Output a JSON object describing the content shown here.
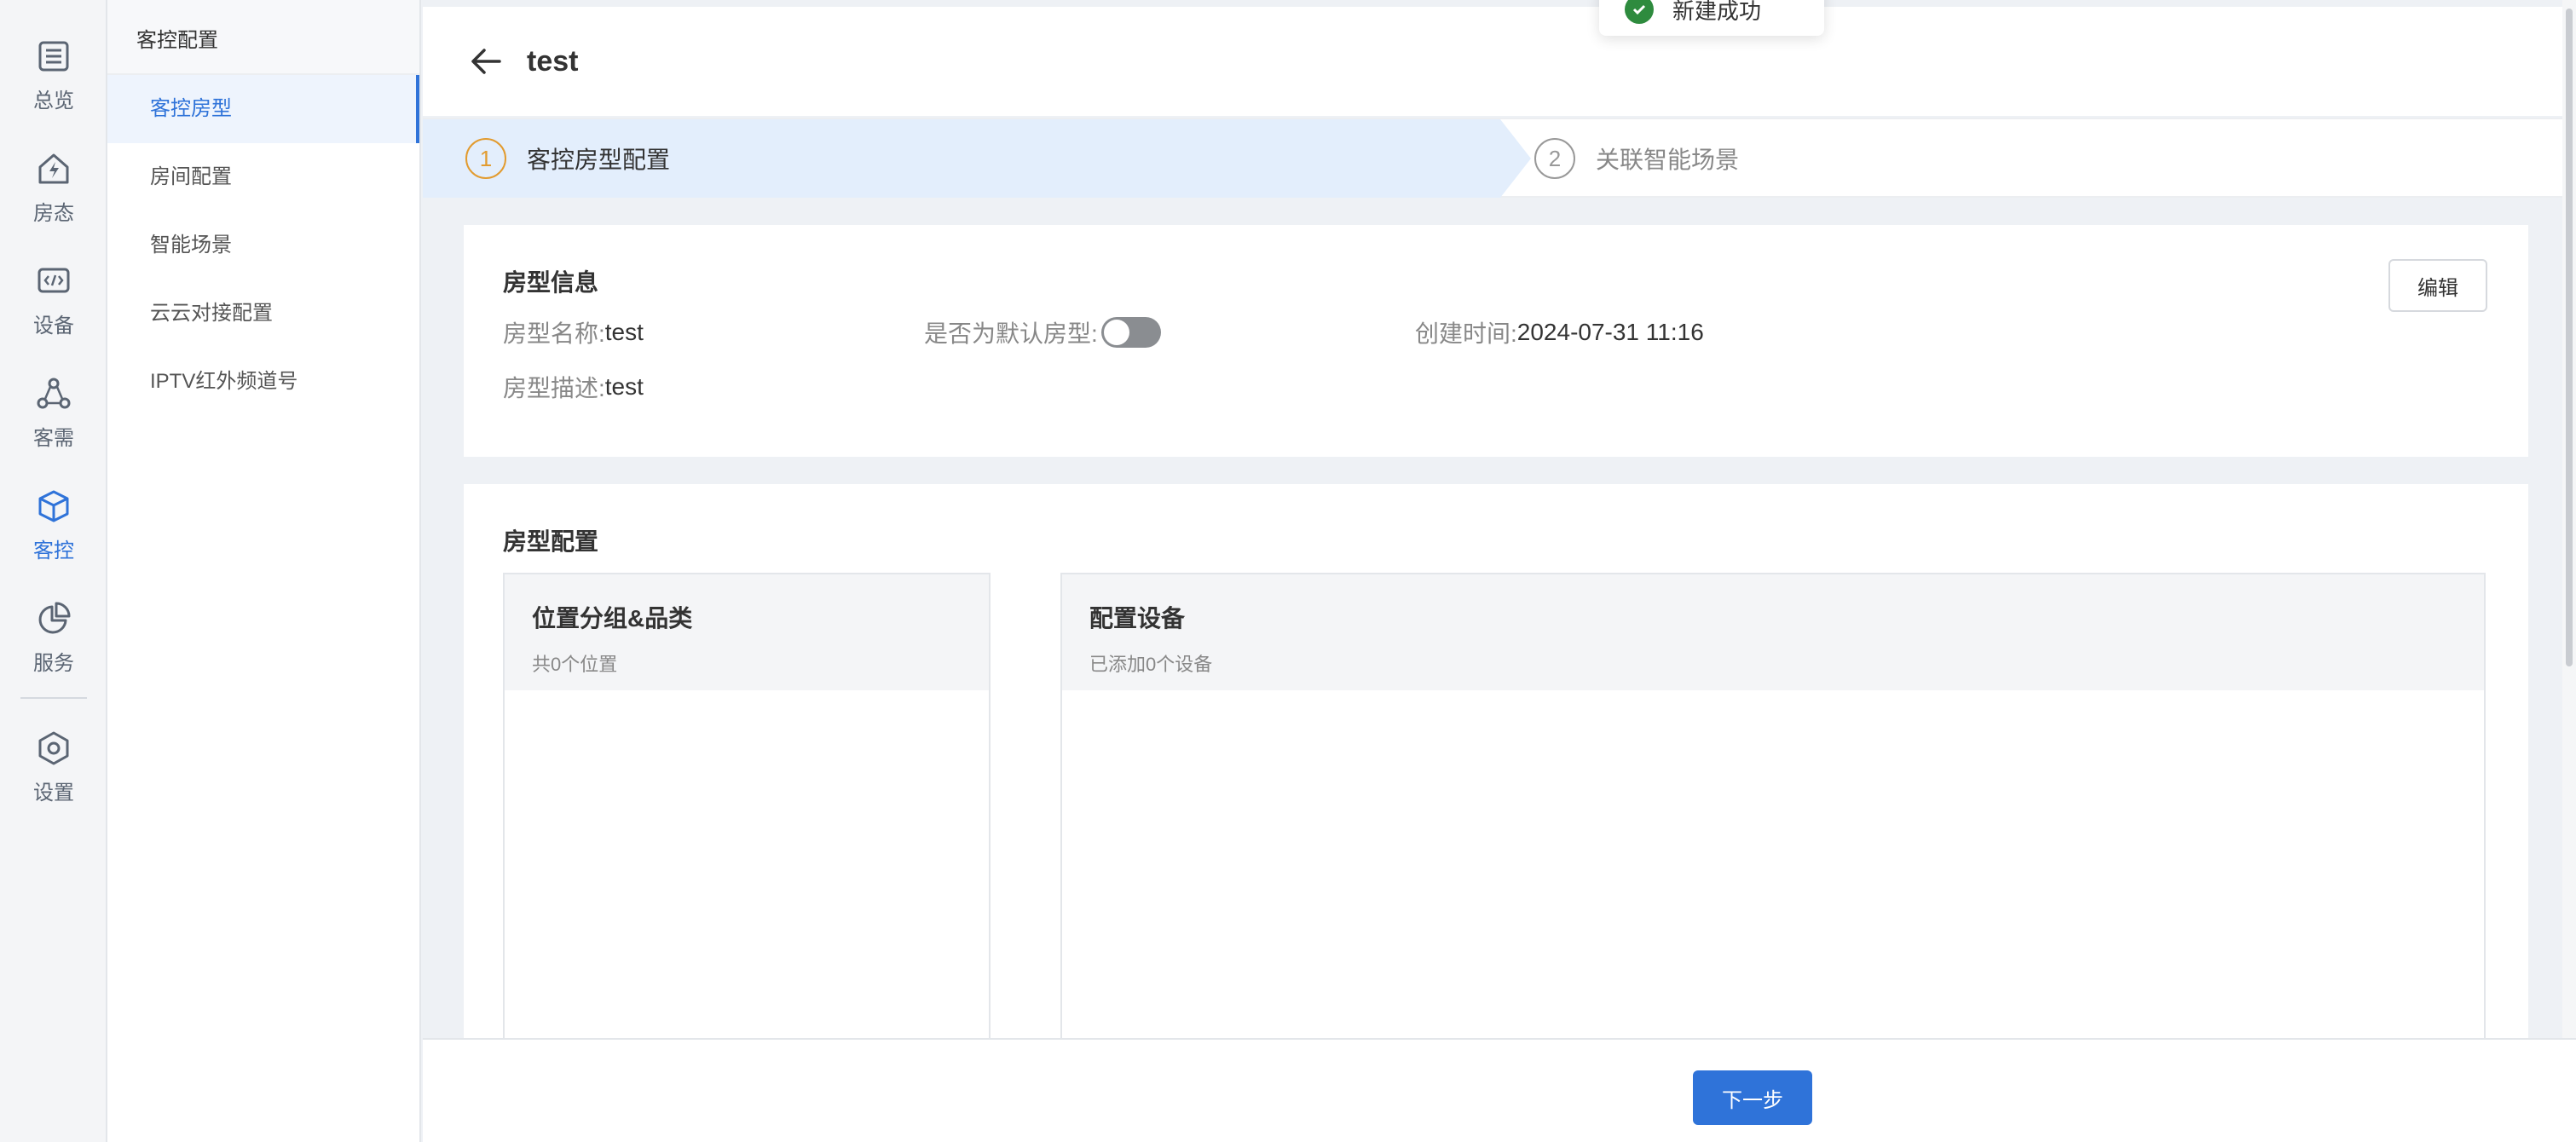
{
  "rail": {
    "items": [
      {
        "label": "总览",
        "icon": "list-icon"
      },
      {
        "label": "房态",
        "icon": "home-bolt-icon"
      },
      {
        "label": "设备",
        "icon": "device-code-icon"
      },
      {
        "label": "客需",
        "icon": "network-icon"
      },
      {
        "label": "客控",
        "icon": "cube-icon",
        "active": true
      },
      {
        "label": "服务",
        "icon": "pie-chart-icon"
      },
      {
        "label": "设置",
        "icon": "settings-hex-icon"
      }
    ]
  },
  "subnav": {
    "title": "客控配置",
    "items": [
      {
        "label": "客控房型",
        "active": true
      },
      {
        "label": "房间配置"
      },
      {
        "label": "智能场景"
      },
      {
        "label": "云云对接配置"
      },
      {
        "label": "IPTV红外频道号"
      }
    ]
  },
  "header": {
    "title": "test"
  },
  "steps": [
    {
      "num": "1",
      "label": "客控房型配置",
      "active": true
    },
    {
      "num": "2",
      "label": "关联智能场景"
    }
  ],
  "room_info": {
    "title": "房型信息",
    "edit_label": "编辑",
    "name_label": "房型名称:",
    "name_value": "test",
    "default_label": "是否为默认房型:",
    "default_on": false,
    "created_label": "创建时间:",
    "created_value": "2024-07-31 11:16",
    "desc_label": "房型描述:",
    "desc_value": "test"
  },
  "room_config": {
    "title": "房型配置",
    "left_panel": {
      "title": "位置分组&品类",
      "sub": "共0个位置"
    },
    "right_panel": {
      "title": "配置设备",
      "sub": "已添加0个设备"
    }
  },
  "footer": {
    "next_label": "下一步"
  },
  "toast": {
    "text": "新建成功"
  },
  "colors": {
    "accent": "#2f73d9",
    "step_active": "#e29b2f",
    "success": "#2e8b3e"
  }
}
